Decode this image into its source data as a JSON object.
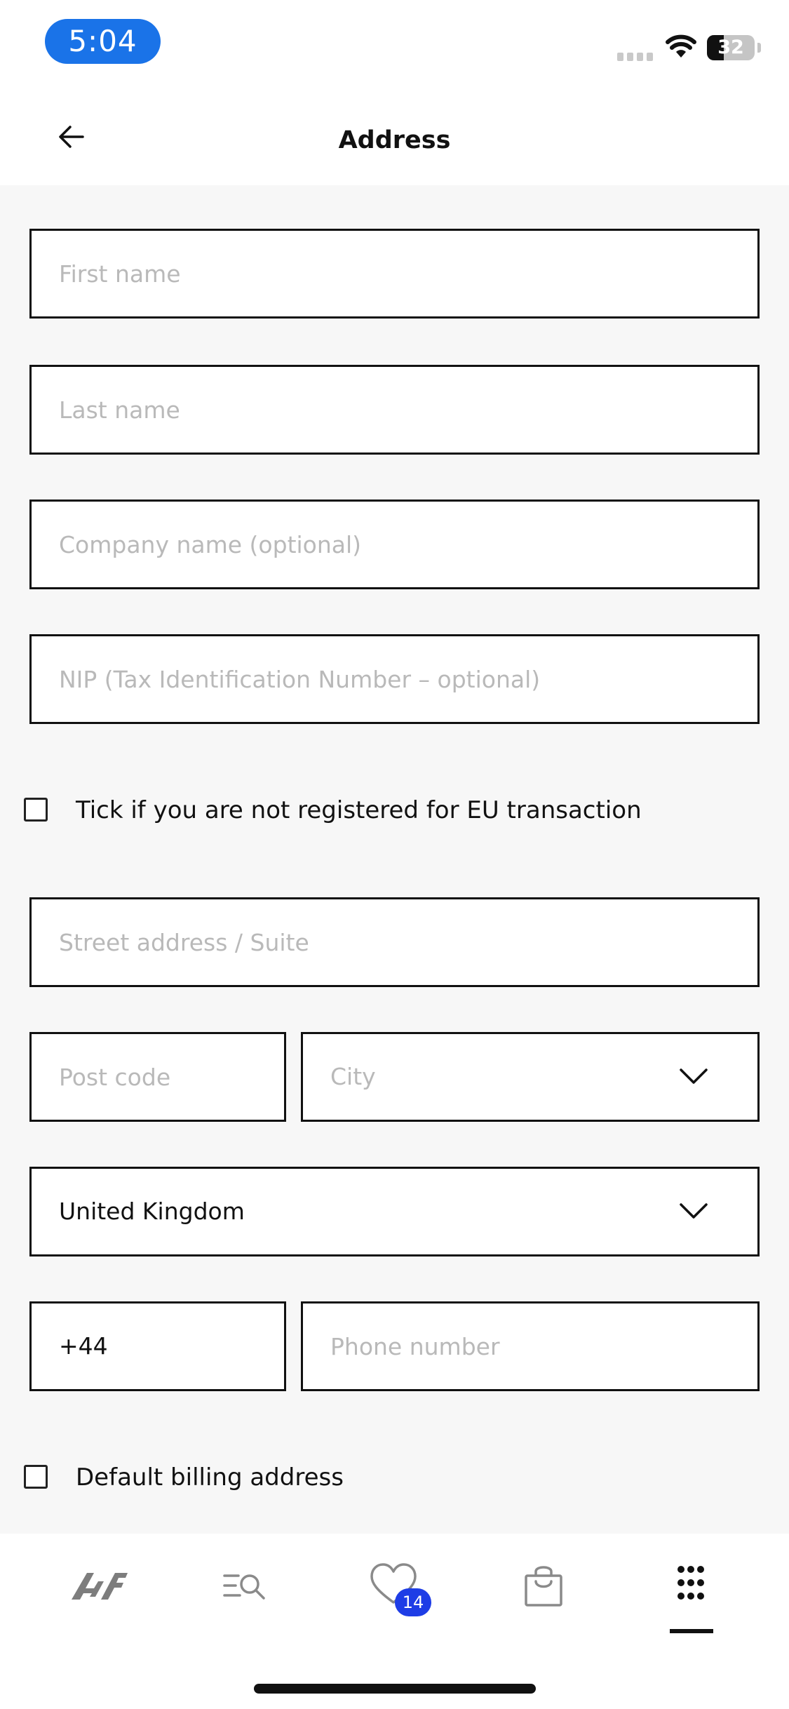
{
  "status_bar": {
    "time": "5:04",
    "battery": "32"
  },
  "header": {
    "title": "Address"
  },
  "form": {
    "first_name_placeholder": "First name",
    "last_name_placeholder": "Last name",
    "company_placeholder": "Company name (optional)",
    "nip_placeholder": "NIP (Tax Identification Number – optional)",
    "eu_checkbox_label": "Tick if you are not registered for EU transaction",
    "street_placeholder": "Street address / Suite",
    "postcode_placeholder": "Post code",
    "city_placeholder": "City",
    "country_value": "United Kingdom",
    "phone_prefix": "+44",
    "phone_placeholder": "Phone number",
    "default_billing_label": "Default billing address"
  },
  "bottom_nav": {
    "items": [
      {
        "icon": "4f-logo-icon"
      },
      {
        "icon": "search-menu-icon"
      },
      {
        "icon": "heart-icon",
        "badge": "14"
      },
      {
        "icon": "shopping-bag-icon"
      },
      {
        "icon": "grid-menu-icon",
        "active": true
      }
    ]
  },
  "colors": {
    "accent": "#1a73e8",
    "badge": "#1e3de6",
    "border": "#111111",
    "placeholder": "#b9b9b9",
    "background": "#f7f7f7"
  }
}
